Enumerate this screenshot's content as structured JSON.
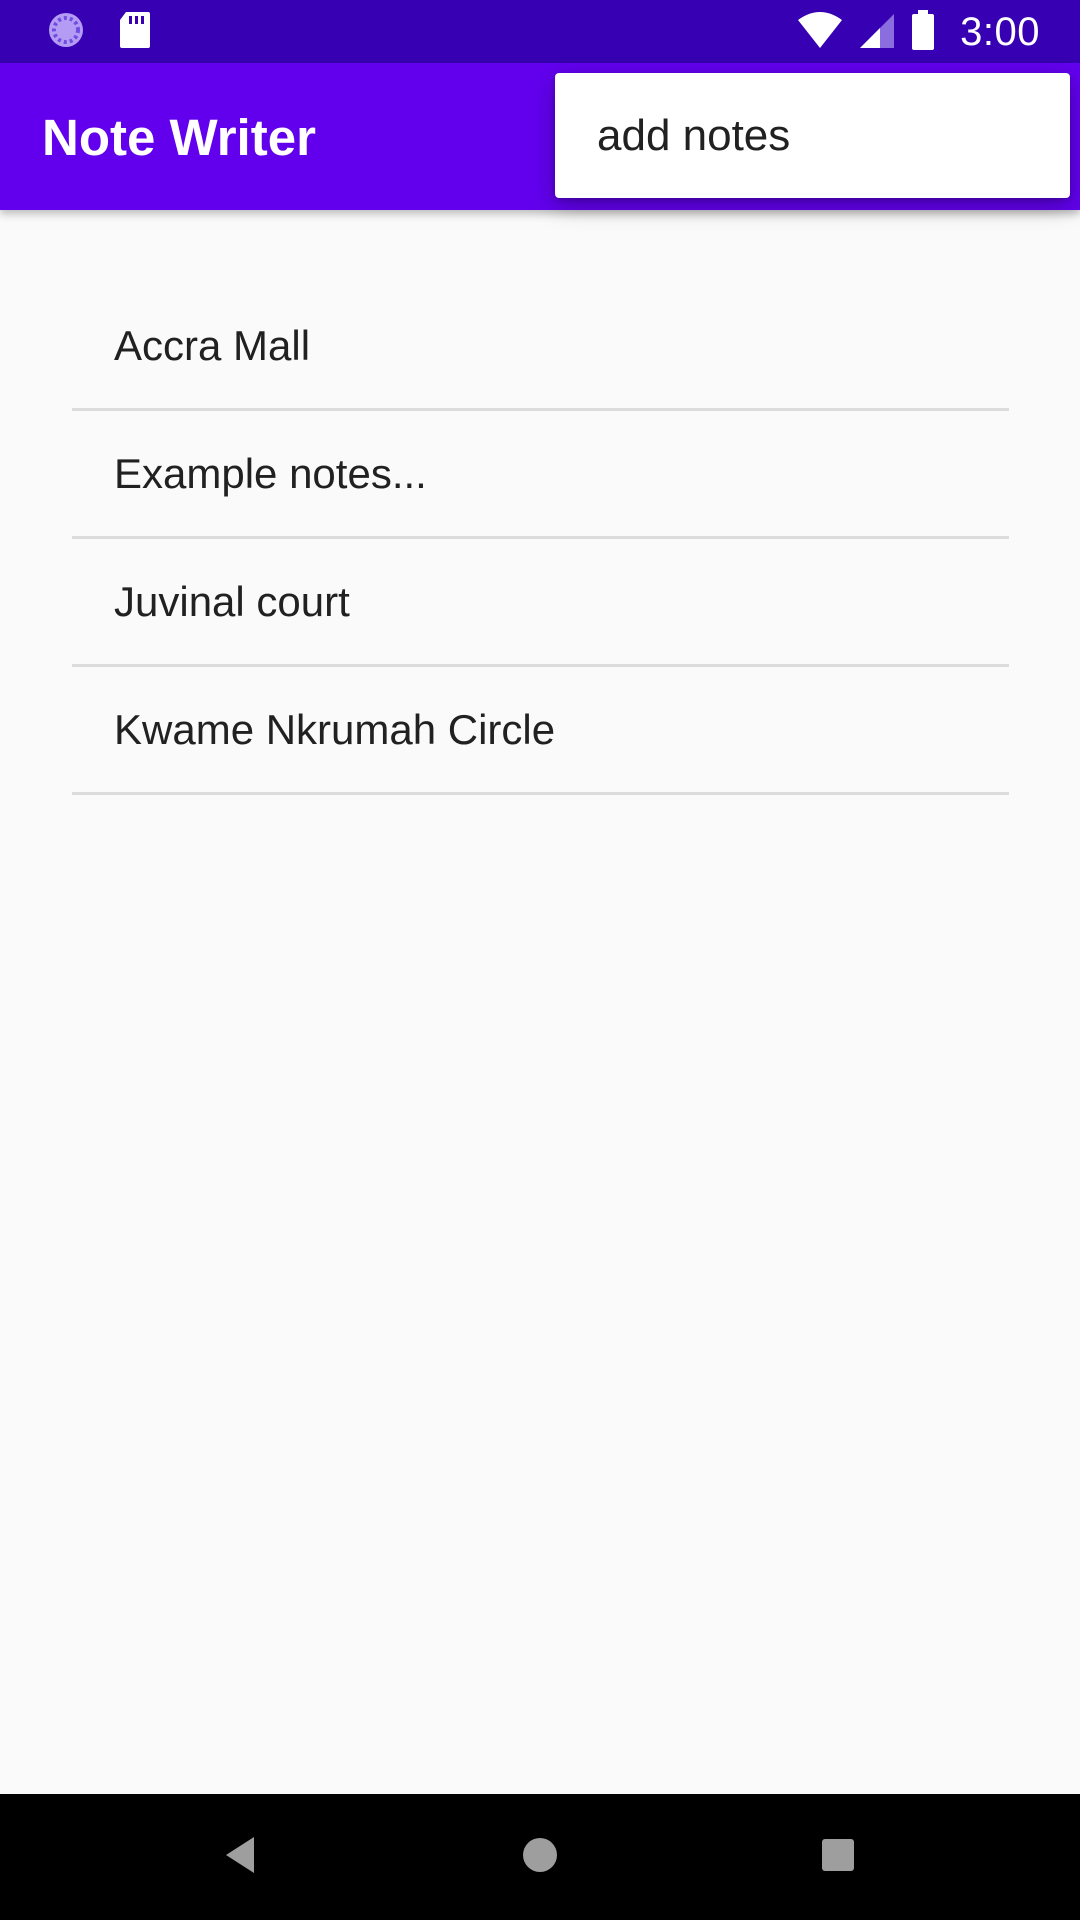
{
  "status_bar": {
    "time": "3:00",
    "icons": [
      "sync-icon",
      "sd-card-icon",
      "wifi-icon",
      "signal-icon",
      "battery-icon"
    ]
  },
  "app_bar": {
    "title": "Note Writer"
  },
  "popup_menu": {
    "items": [
      {
        "label": "add notes"
      }
    ]
  },
  "notes": [
    {
      "title": "Accra Mall"
    },
    {
      "title": "Example notes..."
    },
    {
      "title": "Juvinal court"
    },
    {
      "title": "Kwame Nkrumah Circle"
    }
  ],
  "nav_bar": {
    "buttons": [
      "back-icon",
      "home-icon",
      "recents-icon"
    ]
  },
  "colors": {
    "status_bar": "#3700b3",
    "app_bar": "#6200ee",
    "background": "#fafafa",
    "divider": "#dcdcdc",
    "nav_bar": "#000000"
  }
}
